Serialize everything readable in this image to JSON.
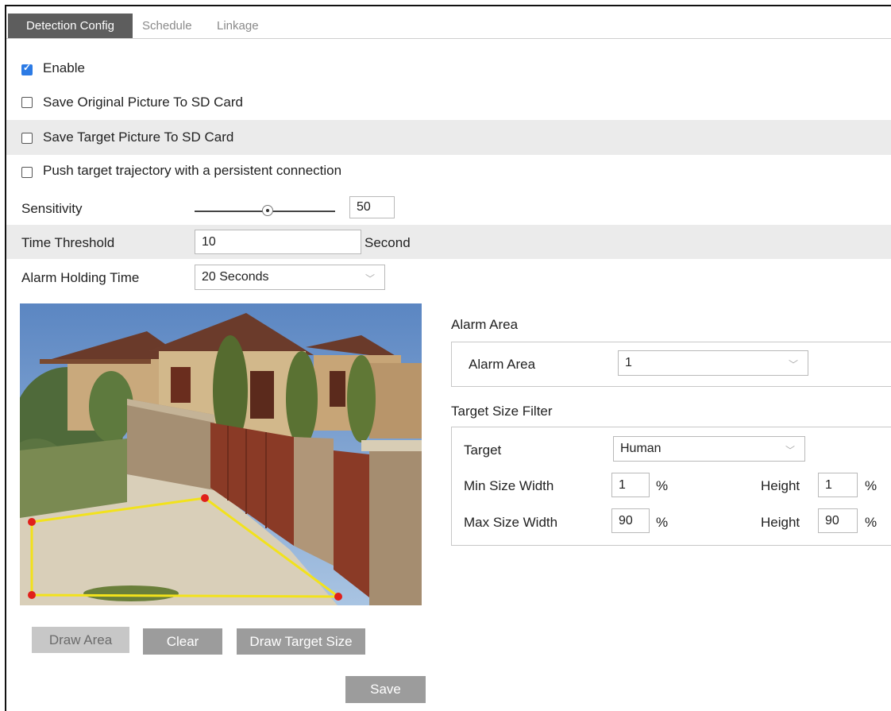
{
  "tabs": [
    {
      "label": "Detection Config",
      "active": true
    },
    {
      "label": "Schedule",
      "active": false
    },
    {
      "label": "Linkage",
      "active": false
    }
  ],
  "enable": {
    "label": "Enable",
    "checked": true
  },
  "save_original": {
    "label": "Save Original Picture To SD Card",
    "checked": false
  },
  "save_target": {
    "label": "Save Target Picture To SD Card",
    "checked": false
  },
  "push_trajectory": {
    "label": "Push target trajectory with a persistent connection",
    "checked": false
  },
  "sensitivity": {
    "label": "Sensitivity",
    "value": "50",
    "level": 50
  },
  "time_threshold": {
    "label": "Time Threshold",
    "value": "10",
    "unit": "Second"
  },
  "alarm_holding": {
    "label": "Alarm Holding Time",
    "value": "20 Seconds"
  },
  "alarm_area": {
    "section_title": "Alarm Area",
    "label": "Alarm Area",
    "value": "1"
  },
  "target_filter": {
    "section_title": "Target Size Filter",
    "target_label": "Target",
    "target_value": "Human",
    "min_label": "Min Size Width",
    "min_width": "1",
    "min_height_label": "Height",
    "min_height": "1",
    "max_label": "Max Size Width",
    "max_width": "90",
    "max_height_label": "Height",
    "max_height": "90",
    "percent": "%"
  },
  "buttons": {
    "draw_area": "Draw Area",
    "clear": "Clear",
    "draw_target_size": "Draw Target Size",
    "save": "Save"
  },
  "colors": {
    "checkbox_checked": "#2c7be5",
    "active_tab": "#5d5d5d",
    "button": "#9c9c9c",
    "area_outline": "#f2e21c",
    "area_vertex": "#e0201a"
  }
}
